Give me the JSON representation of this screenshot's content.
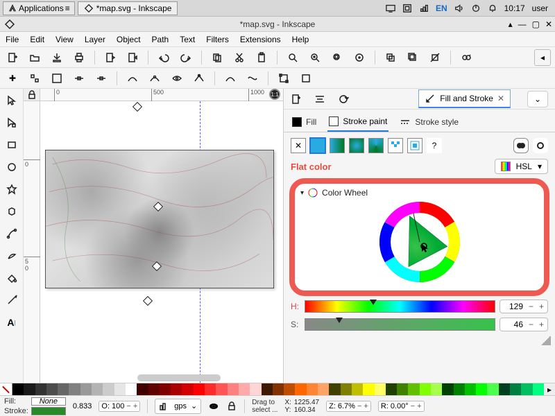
{
  "sys": {
    "apps_label": "Applications",
    "task_title": "*map.svg - Inkscape",
    "lang": "EN",
    "time": "10:17",
    "user": "user"
  },
  "window": {
    "title": "*map.svg - Inkscape"
  },
  "menu": {
    "items": [
      "File",
      "Edit",
      "View",
      "Layer",
      "Object",
      "Path",
      "Text",
      "Filters",
      "Extensions",
      "Help"
    ]
  },
  "ruler": {
    "top": [
      "0",
      "500",
      "1000"
    ],
    "left_0": "0",
    "left_5_0": [
      "5",
      "0"
    ]
  },
  "dock": {
    "tab_label": "Fill and Stroke",
    "tabs": {
      "fill": "Fill",
      "stroke_paint": "Stroke paint",
      "stroke_style": "Stroke style"
    },
    "paint_help": "?",
    "mode_label": "Flat color",
    "color_model": "HSL",
    "wheel_label": "Color Wheel",
    "h_label": "H:",
    "s_label": "S:",
    "h_value": "129",
    "s_value": "46"
  },
  "status": {
    "fill_label": "Fill:",
    "stroke_label": "Stroke:",
    "fill_value": "None",
    "stroke_value_text": "",
    "stroke_width": "0.833",
    "opacity_label": "O:",
    "opacity": "100",
    "layer": "gps",
    "hint_l1": "Drag to",
    "hint_l2": "select ...",
    "x_label": "X:",
    "x": "1225.47",
    "y_label": "Y:",
    "y": "160.34",
    "z_label": "Z:",
    "zoom": "6.7%",
    "r_label": "R:",
    "rot": "0.00°"
  },
  "unit_badge": "1:1",
  "chart_data": {
    "type": "table",
    "note": "no chart in image"
  }
}
